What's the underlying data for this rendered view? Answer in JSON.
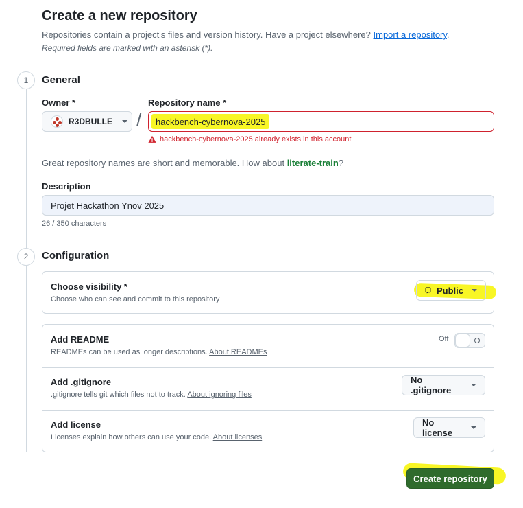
{
  "header": {
    "title": "Create a new repository",
    "subtitle": "Repositories contain a project's files and version history. Have a project elsewhere?",
    "import_link": "Import a repository",
    "import_suffix": ".",
    "required_note": "Required fields are marked with an asterisk (*)."
  },
  "general": {
    "step": "1",
    "title": "General",
    "owner_label": "Owner *",
    "owner_value": "R3DBULLE",
    "repo_label": "Repository name *",
    "repo_value": "hackbench-cybernova-2025",
    "error_text": "hackbench-cybernova-2025 already exists in this account",
    "hint_prefix": "Great repository names are short and memorable. How about",
    "hint_suggestion": "literate-train",
    "hint_suffix": "?",
    "description_label": "Description",
    "description_value": "Projet Hackathon Ynov 2025",
    "char_count": "26 / 350 characters"
  },
  "configuration": {
    "step": "2",
    "title": "Configuration",
    "visibility": {
      "title": "Choose visibility *",
      "subtitle": "Choose who can see and commit to this repository",
      "value": "Public"
    },
    "readme": {
      "title": "Add README",
      "subtitle": "READMEs can be used as longer descriptions.",
      "link": "About READMEs",
      "toggle_label": "Off"
    },
    "gitignore": {
      "title": "Add .gitignore",
      "subtitle": ".gitignore tells git which files not to track.",
      "link": "About ignoring files",
      "value": "No .gitignore"
    },
    "license": {
      "title": "Add license",
      "subtitle": "Licenses explain how others can use your code.",
      "link": "About licenses",
      "value": "No license"
    }
  },
  "actions": {
    "create_label": "Create repository"
  },
  "colors": {
    "highlight": "#f7f500",
    "error": "#d1242f",
    "primary_button": "#2f6b2c",
    "link": "#0969da",
    "suggestion": "#1a7f37"
  },
  "icons": {
    "warning": "alert-triangle-icon",
    "repo": "repo-book-icon",
    "caret": "triangle-down-icon"
  }
}
